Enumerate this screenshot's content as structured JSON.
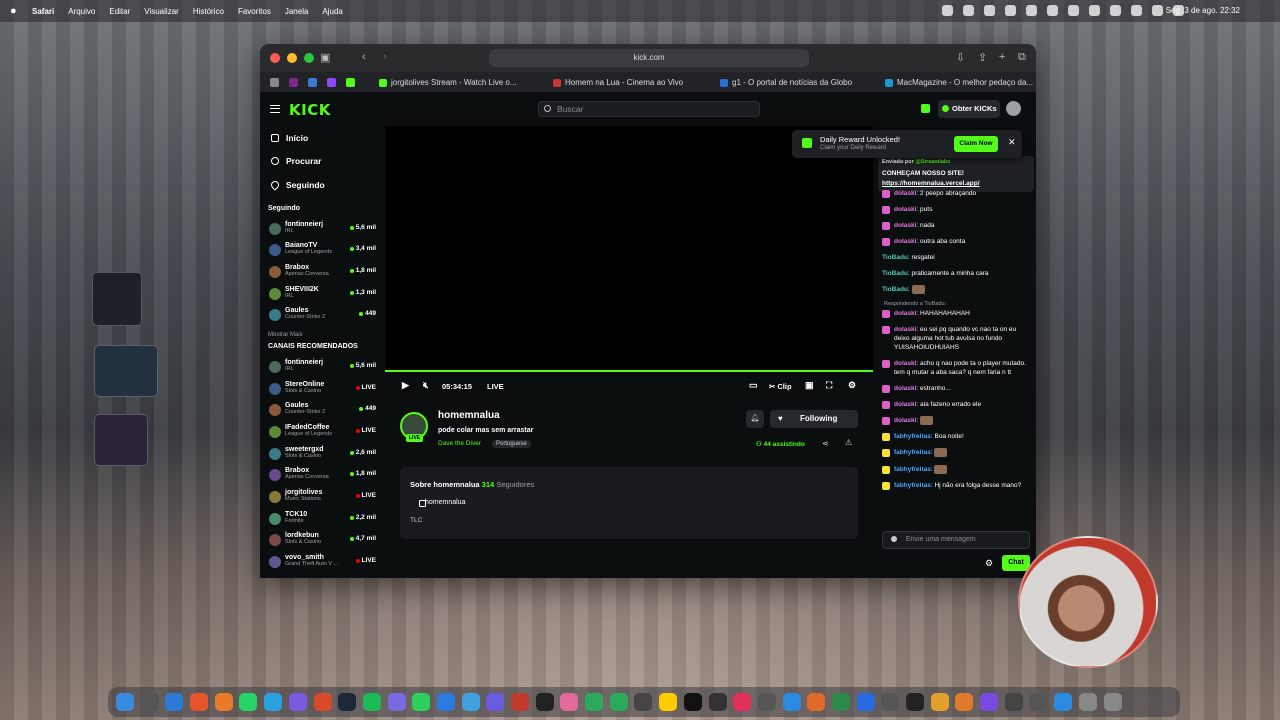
{
  "menubar": {
    "app": "Safari",
    "items": [
      "Arquivo",
      "Editar",
      "Visualizar",
      "Histórico",
      "Favoritos",
      "Janela",
      "Ajuda"
    ],
    "clock": "Seg. 3 de ago.  22:32"
  },
  "browser": {
    "url": "kick.com",
    "tabs": [
      "jorgitolives Stream - Watch Live o...",
      "Homem na Lua - Cinema ao Vivo",
      "g1 - O portal de notícias da Globo",
      "MacMagazine - O melhor pedaço da..."
    ]
  },
  "kick": {
    "logo": "KICK",
    "search_placeholder": "Buscar",
    "get_kicks": "Obter KICKs",
    "nav": [
      {
        "label": "Início"
      },
      {
        "label": "Procurar"
      },
      {
        "label": "Seguindo"
      }
    ],
    "following_title": "Seguindo",
    "following": [
      {
        "name": "fontinneierj",
        "cat": "IRL",
        "viewers": "5,6 mil"
      },
      {
        "name": "BaianoTV",
        "cat": "League of Legends",
        "viewers": "3,4 mil"
      },
      {
        "name": "Brabox",
        "cat": "Apenas Conversa",
        "viewers": "1,8 mil"
      },
      {
        "name": "SHEVIII2K",
        "cat": "IRL",
        "viewers": "1,3 mil"
      },
      {
        "name": "Gaules",
        "cat": "Counter-Strike 2",
        "viewers": "449"
      }
    ],
    "show_more": "Mostrar Mais",
    "recommended_title": "CANAIS RECOMENDADOS",
    "recommended": [
      {
        "name": "fontinneierj",
        "cat": "IRL",
        "viewers": "5,6 mil"
      },
      {
        "name": "StereOnline",
        "cat": "Slots & Casino",
        "viewers": "LIVE"
      },
      {
        "name": "Gaules",
        "cat": "Counter-Strike 2",
        "viewers": "449"
      },
      {
        "name": "IFadedCoffee",
        "cat": "League of Legends",
        "viewers": "LIVE"
      },
      {
        "name": "sweetergxd",
        "cat": "Slots & Casino",
        "viewers": "2,6 mil"
      },
      {
        "name": "Brabox",
        "cat": "Apenas Conversa",
        "viewers": "1,8 mil"
      },
      {
        "name": "jorgitolives",
        "cat": "Music Stations",
        "viewers": "LIVE"
      },
      {
        "name": "TCK10",
        "cat": "Fortnite",
        "viewers": "2,2 mil"
      },
      {
        "name": "lordkebun",
        "cat": "Slots & Casino",
        "viewers": "4,7 mil"
      },
      {
        "name": "vovo_smith",
        "cat": "Grand Theft Auto V ...",
        "viewers": "LIVE"
      }
    ],
    "player": {
      "time": "05:34:15",
      "live": "LIVE",
      "clip": "Clip"
    },
    "stream": {
      "username": "homemnalua",
      "title": "pode colar mas sem arrastar",
      "game": "Dave the Diver",
      "language": "Portuguese",
      "live_badge": "LIVE",
      "follow": "Following",
      "viewers": "44 assistindo"
    },
    "about": {
      "title": "Sobre homemnalua",
      "followers": "314",
      "followers_label": "Seguidores",
      "instagram": "homemnalua",
      "bio": "TLC"
    },
    "reward": {
      "title": "Daily Reward Unlocked!",
      "subtitle": "Claim your Daily Reward",
      "claim": "Claim Now"
    },
    "pinned": {
      "by": "Enviado por",
      "by_user": "@Streamlabs",
      "message": "CONHEÇAM NOSSO SITE!",
      "link": "https://homemnalua.vercel.app/"
    },
    "chat": [
      {
        "user": "dolaski",
        "color": "p",
        "text": "2 peepo abraçando"
      },
      {
        "user": "dolaski",
        "color": "p",
        "text": "puts"
      },
      {
        "user": "dolaski",
        "color": "p",
        "text": "nada"
      },
      {
        "user": "dolaski",
        "color": "p",
        "text": "outra aba conta"
      },
      {
        "user": "TioBadu",
        "color": "g",
        "text": "resgatei",
        "nobadge": true
      },
      {
        "user": "TioBadu",
        "color": "g",
        "text": "praticamente a minha cara",
        "nobadge": true
      },
      {
        "user": "TioBadu",
        "color": "g",
        "text": "",
        "emote": true,
        "nobadge": true
      },
      {
        "reply": "Respondendo a TioBadu:",
        "user": "dolaski",
        "color": "p",
        "text": "HAHAHAHAHAH"
      },
      {
        "user": "dolaski",
        "color": "p",
        "text": "eu sei pq quando vc nao ta on eu deixo alguma hot tub avulsa no fundo YUISAHOIUDHUIAHS"
      },
      {
        "user": "dolaski",
        "color": "p",
        "text": "acho q nao pode ta o player mutado. tem q mutar a aba saca? q nem faria n tt"
      },
      {
        "user": "dolaski",
        "color": "p",
        "text": "estranho..."
      },
      {
        "user": "dolaski",
        "color": "p",
        "text": "ala fazeno errado ele"
      },
      {
        "user": "dolaski",
        "color": "p",
        "text": "",
        "emote": true
      },
      {
        "user": "fabhyfreitas",
        "color": "b2",
        "badge": "y",
        "text": "Boa noite!"
      },
      {
        "user": "fabhyfreitas",
        "color": "b2",
        "badge": "y",
        "text": "",
        "emote": true
      },
      {
        "user": "fabhyfreitas",
        "color": "b2",
        "badge": "y",
        "text": "",
        "emote": true
      },
      {
        "user": "fabhyfreitas",
        "color": "b2",
        "badge": "y",
        "text": "Hj não era folga desse mano?"
      }
    ],
    "chat_placeholder": "Envie uma mensagem",
    "chat_button": "Chat"
  }
}
